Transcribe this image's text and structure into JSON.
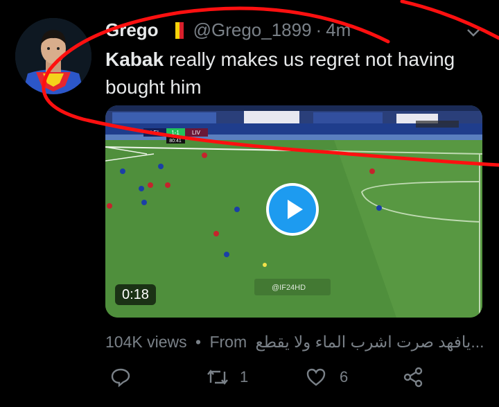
{
  "tweet": {
    "display_name": "Grego",
    "handle": "@Grego_1899",
    "separator": "·",
    "time": "4m",
    "text_bold": "Kabak",
    "text_rest": " really makes us regret not having bought him",
    "video_duration": "0:18",
    "scoreboard": {
      "home": "LEI",
      "score": "1-1",
      "away": "LIV",
      "clock": "80:41"
    },
    "watermark": "@IF24HD",
    "views_line": "104K views",
    "views_sep": "•",
    "from_label": "From",
    "from_source": "يافهد صرت اشرب الماء ولا يقطع...",
    "retweet_count": "1",
    "like_count": "6"
  },
  "icons": [
    "more-icon",
    "play-icon",
    "reply-icon",
    "retweet-icon",
    "like-icon",
    "share-icon"
  ],
  "colors": {
    "background": "#000000",
    "text": "#e7e9ea",
    "muted": "#7a8188",
    "annotation_red": "#ff1010",
    "play_blue": "#1d9bf0"
  }
}
